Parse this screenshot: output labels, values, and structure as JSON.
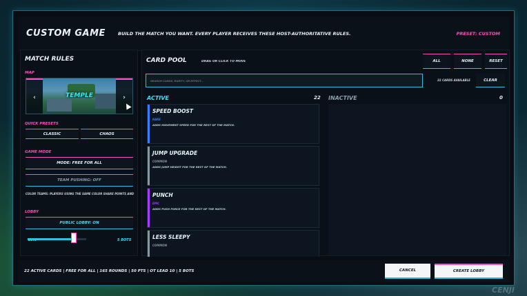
{
  "header": {
    "title": "CUSTOM GAME",
    "subtitle": "BUILD THE MATCH YOU WANT. EVERY PLAYER RECEIVES THESE HOST-AUTHORITATIVE RULES.",
    "preset": "PRESET: CUSTOM"
  },
  "match_rules": {
    "title": "MATCH RULES",
    "map_label": "MAP",
    "map_name": "TEMPLE",
    "prev": "‹",
    "next": "›",
    "quick_presets_label": "QUICK PRESETS",
    "preset_classic": "CLASSIC",
    "preset_chaos": "CHAOS",
    "game_mode_label": "GAME MODE",
    "mode": "MODE: FREE FOR ALL",
    "team_pushing": "TEAM PUSHING: OFF",
    "color_teams": "COLOR TEAMS: PLAYERS USING THE SAME COLOR SHARE POINTS AND WIN TOGETHER.",
    "lobby_label": "LOBBY",
    "public_lobby": "PUBLIC LOBBY: ON",
    "bots_label": "BOTS",
    "bots_value": "5 BOTS",
    "bots_fraction": 0.76
  },
  "card_pool": {
    "title": "CARD POOL",
    "hint": "DRAG OR CLICK TO MOVE",
    "btn_all": "ALL",
    "btn_none": "NONE",
    "btn_reset": "RESET",
    "search_placeholder": "SEARCH CARDS, RARITY, OR EFFECT...",
    "cards_available": "22 CARDS AVAILABLE",
    "clear": "CLEAR",
    "active_label": "ACTIVE",
    "active_count": "22",
    "inactive_label": "INACTIVE",
    "inactive_count": "0",
    "cards": [
      {
        "name": "SPEED BOOST",
        "rarity": "RARE",
        "rarity_color": "#3a7bff",
        "desc": "ADDS MOVEMENT SPEED FOR THE REST OF THE MATCH."
      },
      {
        "name": "JUMP UPGRADE",
        "rarity": "COMMON",
        "rarity_color": "#8a96a0",
        "desc": "ADDS JUMP HEIGHT FOR THE REST OF THE MATCH."
      },
      {
        "name": "PUNCH",
        "rarity": "EPIC",
        "rarity_color": "#a63aff",
        "desc": "ADDS PUSH FORCE FOR THE REST OF THE MATCH."
      },
      {
        "name": "LESS SLEEPY",
        "rarity": "COMMON",
        "rarity_color": "#8a96a0",
        "desc": ""
      }
    ]
  },
  "footer": {
    "summary": "22 ACTIVE CARDS | FREE FOR ALL | 165 ROUNDS | 50 PTS | OT LEAD 10 | 5 BOTS",
    "cancel": "CANCEL",
    "create": "CREATE LOBBY"
  },
  "watermark": "CENJI"
}
